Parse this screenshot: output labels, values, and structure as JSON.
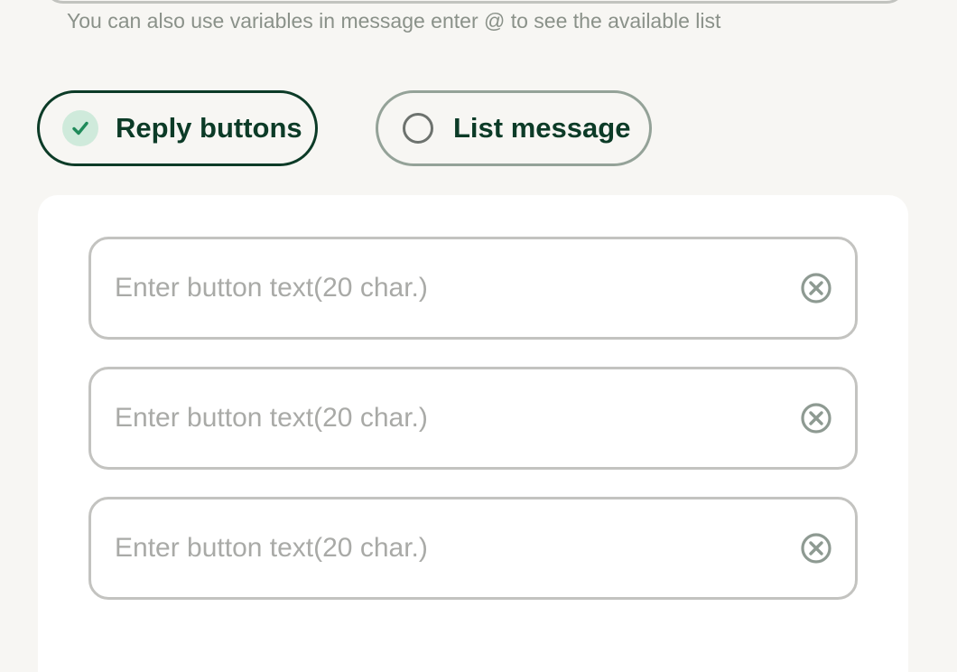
{
  "message": {
    "variables_hint": "You can also use variables in message enter @ to see the available list"
  },
  "message_type": {
    "options": [
      {
        "label": "Reply buttons",
        "selected": true,
        "icon": "check-icon"
      },
      {
        "label": "List message",
        "selected": false,
        "icon": "radio-icon"
      }
    ]
  },
  "reply_buttons": {
    "fields": [
      {
        "value": "",
        "placeholder": "Enter button text(20 char.)",
        "clear_icon": "clear-circle-icon"
      },
      {
        "value": "",
        "placeholder": "Enter button text(20 char.)",
        "clear_icon": "clear-circle-icon"
      },
      {
        "value": "",
        "placeholder": "Enter button text(20 char.)",
        "clear_icon": "clear-circle-icon"
      }
    ]
  },
  "colors": {
    "accent_dark_green": "#0c3b27",
    "check_green": "#1f8a5a",
    "check_bg": "#cfeadb",
    "page_background": "#f7f6f3",
    "muted_text": "#8a9189",
    "placeholder_text": "#a9aaa7"
  }
}
